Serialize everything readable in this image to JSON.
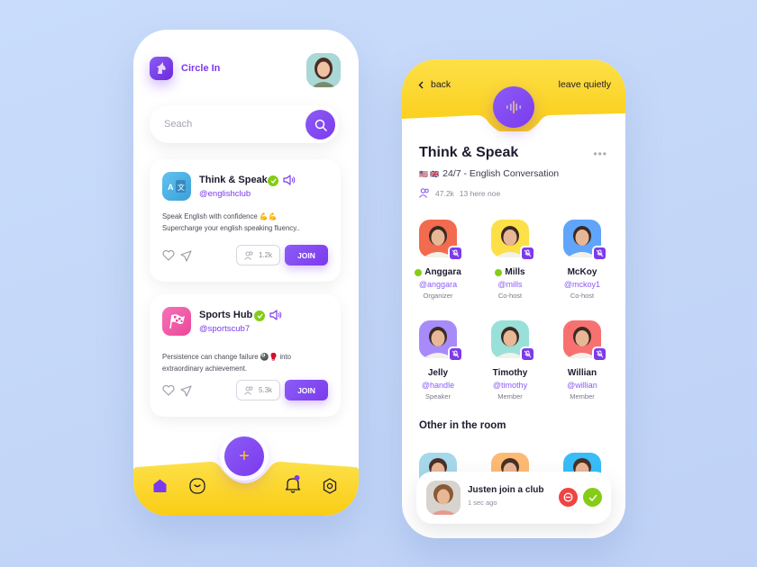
{
  "colors": {
    "accent": "#7c3aed",
    "yellow": "#facc15",
    "online": "#84cc16",
    "danger": "#ef4444",
    "background": "#c6d9f9"
  },
  "home": {
    "app_name": "Circle In",
    "logo_icon": "unicorn-icon",
    "search": {
      "placeholder": "Seach",
      "icon": "search-icon"
    },
    "clubs": [
      {
        "name": "Think & Speak",
        "handle": "@englishclub",
        "icon": "translate-icon",
        "verified": true,
        "audio": true,
        "description_line1": "Speak English with confidence 💪💪",
        "description_line2": "Supercharge your english speaking fluency..",
        "members": "1.2k",
        "join_label": "JOIN"
      },
      {
        "name": "Sports Hub",
        "handle": "@sportscub7",
        "icon": "checkered-flag-icon",
        "verified": true,
        "audio": true,
        "description_line1": "Persistence can change failure 🎱🥊 into",
        "description_line2": "extraordinary achievement.",
        "members": "5.3k",
        "join_label": "JOIN"
      }
    ],
    "fab_label": "+",
    "nav": [
      "home-icon",
      "smile-icon",
      "bell-icon",
      "settings-icon"
    ],
    "bell_has_badge": true
  },
  "room": {
    "back_label": "back",
    "leave_label": "leave quietly",
    "title": "Think & Speak",
    "more_label": "•••",
    "flags": "🇺🇸 🇬🇧",
    "subtitle": "24/7 - English Conversation",
    "followers": "47.2k",
    "here_now": "13 here noe",
    "members": [
      {
        "name": "Anggara",
        "handle": "@anggara",
        "role": "Organizer",
        "online": true,
        "muted": true,
        "bg": "#f26b4f"
      },
      {
        "name": "Mills",
        "handle": "@mills",
        "role": "Co-host",
        "online": true,
        "muted": true,
        "bg": "#fde047"
      },
      {
        "name": "McKoy",
        "handle": "@mckoy1",
        "role": "Co-host",
        "online": false,
        "muted": true,
        "bg": "#60a5fa"
      },
      {
        "name": "Jelly",
        "handle": "@handle",
        "role": "Speaker",
        "online": false,
        "muted": true,
        "bg": "#a78bfa"
      },
      {
        "name": "Timothy",
        "handle": "@timothy",
        "role": "Member",
        "online": false,
        "muted": true,
        "bg": "#99e0d9"
      },
      {
        "name": "Willian",
        "handle": "@willian",
        "role": "Member",
        "online": false,
        "muted": true,
        "bg": "#f87171"
      }
    ],
    "others_title": "Other in the room",
    "others": [
      {
        "bg": "#a5d8ea"
      },
      {
        "bg": "#fdba74"
      },
      {
        "bg": "#38bdf8"
      }
    ],
    "toast": {
      "title": "Justen join a club",
      "time": "1 sec ago",
      "decline": "decline",
      "accept": "accept"
    }
  }
}
